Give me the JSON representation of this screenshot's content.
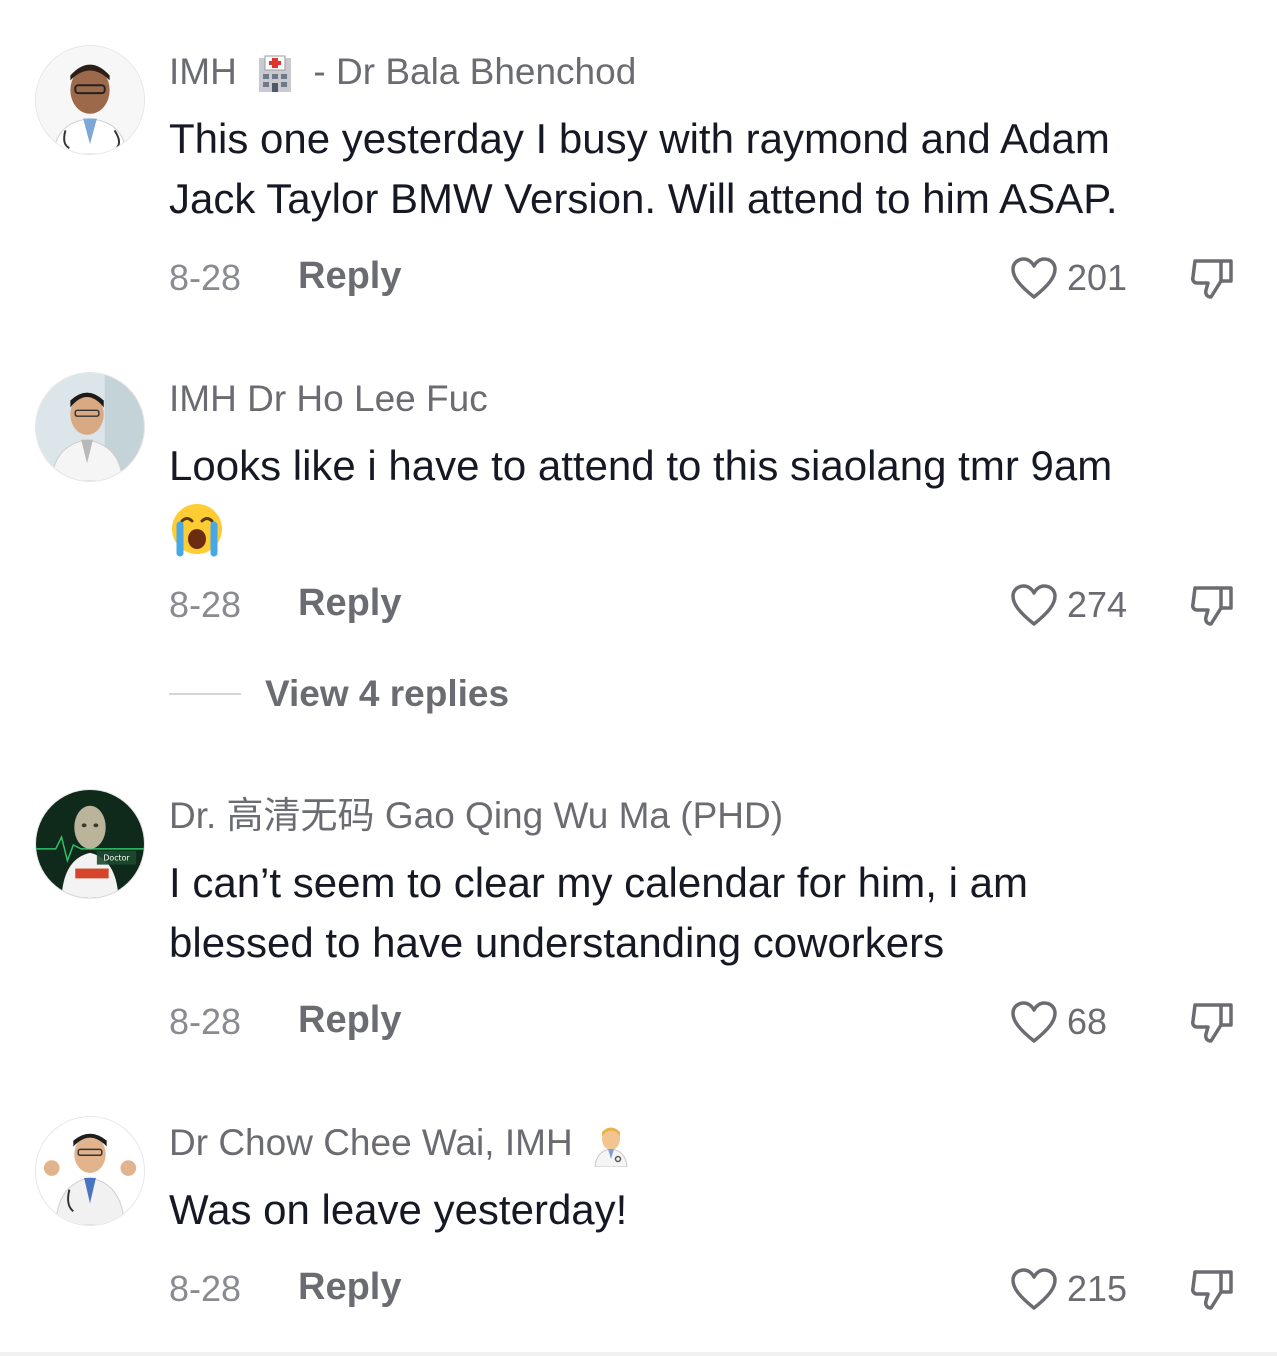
{
  "comments": [
    {
      "user_prefix": "IMH",
      "user_name": "- Dr Bala Bhenchod",
      "text_line1": "This one yesterday I busy with raymond and Adam",
      "text_line2": "Jack Taylor BMW Version. Will attend to him ASAP.",
      "date": "8-28",
      "reply_label": "Reply",
      "likes": "201"
    },
    {
      "user_name": "IMH Dr Ho Lee Fuc",
      "text_line1": "Looks like i have to attend to this siaolang tmr 9am",
      "text_line2": "",
      "date": "8-28",
      "reply_label": "Reply",
      "likes": "274",
      "view_replies": "View 4 replies"
    },
    {
      "user_name": "Dr. 高清无码 Gao Qing Wu Ma (PHD)",
      "text_line1": "I can’t seem to clear my calendar for him, i am",
      "text_line2": "blessed to have understanding coworkers",
      "date": "8-28",
      "reply_label": "Reply",
      "likes": "68",
      "avatar_caption": "Doctor"
    },
    {
      "user_name": "Dr Chow Chee Wai, IMH",
      "text_line1": "Was on leave yesterday!",
      "text_line2": "",
      "date": "8-28",
      "reply_label": "Reply",
      "likes": "215"
    }
  ],
  "icons": {
    "like": "heart-outline-icon",
    "dislike": "thumbs-down-icon",
    "hospital": "hospital-emoji",
    "cry": "loudly-crying-face-emoji",
    "doctor": "man-health-worker-emoji"
  },
  "colors": {
    "primary_text": "#161823",
    "secondary_text": "#6b6c72",
    "date_text": "#8a8b91"
  }
}
